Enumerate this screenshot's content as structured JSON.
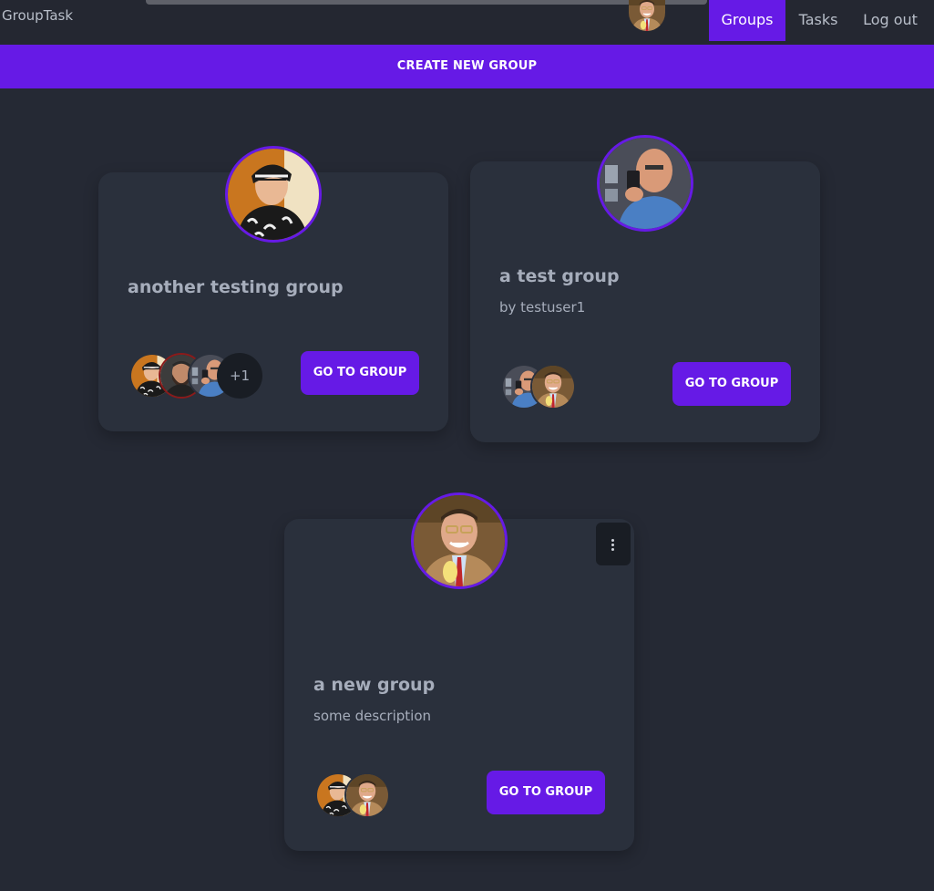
{
  "navbar": {
    "brand": "GroupTask",
    "links": [
      {
        "label": "Groups",
        "active": true
      },
      {
        "label": "Tasks",
        "active": false
      },
      {
        "label": "Log out",
        "active": false
      }
    ]
  },
  "create_button": {
    "label": "CREATE NEW GROUP"
  },
  "colors": {
    "accent": "#661ae6",
    "background": "#252934",
    "card": "#2a303c"
  },
  "groups": [
    {
      "title": "another testing group",
      "description": "",
      "button_label": "GO TO GROUP",
      "members_overflow": "+1"
    },
    {
      "title": "a test group",
      "description": "by testuser1",
      "button_label": "GO TO GROUP"
    },
    {
      "title": "a new group",
      "description": "some description",
      "button_label": "GO TO GROUP"
    }
  ]
}
